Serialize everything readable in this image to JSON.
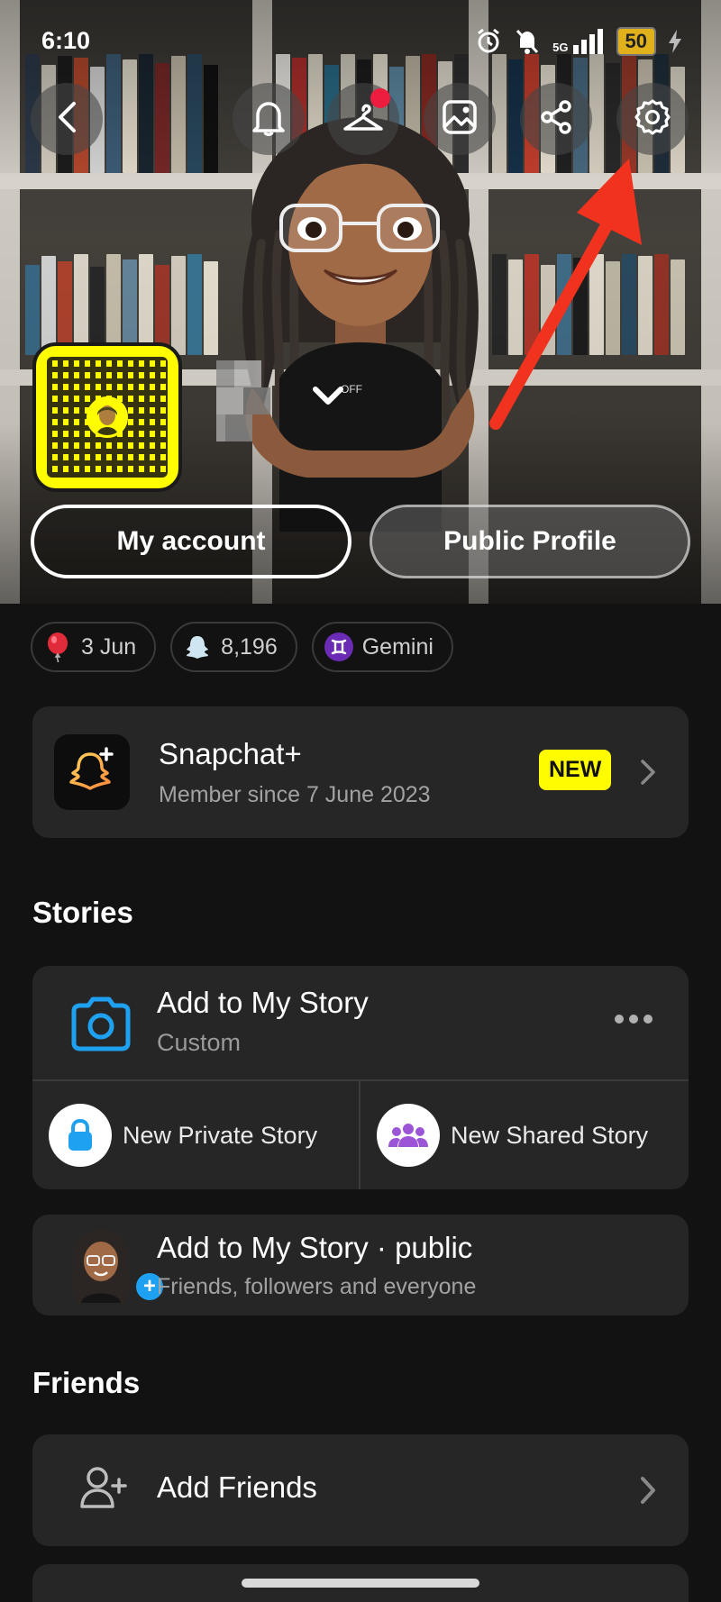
{
  "status_bar": {
    "time": "6:10",
    "network": "5G",
    "battery": "50"
  },
  "top_actions": {
    "back": "back-icon",
    "notifications": "bell-icon",
    "outfit": "hanger-icon",
    "cameo": "image-icon",
    "share": "share-icon",
    "settings": "gear-icon"
  },
  "hero": {
    "my_account_label": "My account",
    "public_profile_label": "Public Profile"
  },
  "chips": [
    {
      "icon": "balloon-icon",
      "label": "3 Jun"
    },
    {
      "icon": "ghost-icon",
      "label": "8,196"
    },
    {
      "icon": "gemini-icon",
      "label": "Gemini"
    }
  ],
  "snapchat_plus": {
    "title": "Snapchat+",
    "subtitle": "Member since 7 June 2023",
    "badge": "NEW"
  },
  "stories": {
    "section_title": "Stories",
    "add_title": "Add to My Story",
    "add_subtitle": "Custom",
    "private_label": "New Private Story",
    "shared_label": "New Shared Story",
    "public_title": "Add to My Story · public",
    "public_subtitle": "Friends, followers and everyone"
  },
  "friends": {
    "section_title": "Friends",
    "add_label": "Add Friends"
  },
  "colors": {
    "snap_yellow": "#fffc00",
    "accent_blue": "#1ea1f1",
    "notification_red": "#ec1d3f",
    "arrow_red": "#f0321e",
    "card_bg": "#262626",
    "page_bg": "#121212"
  }
}
